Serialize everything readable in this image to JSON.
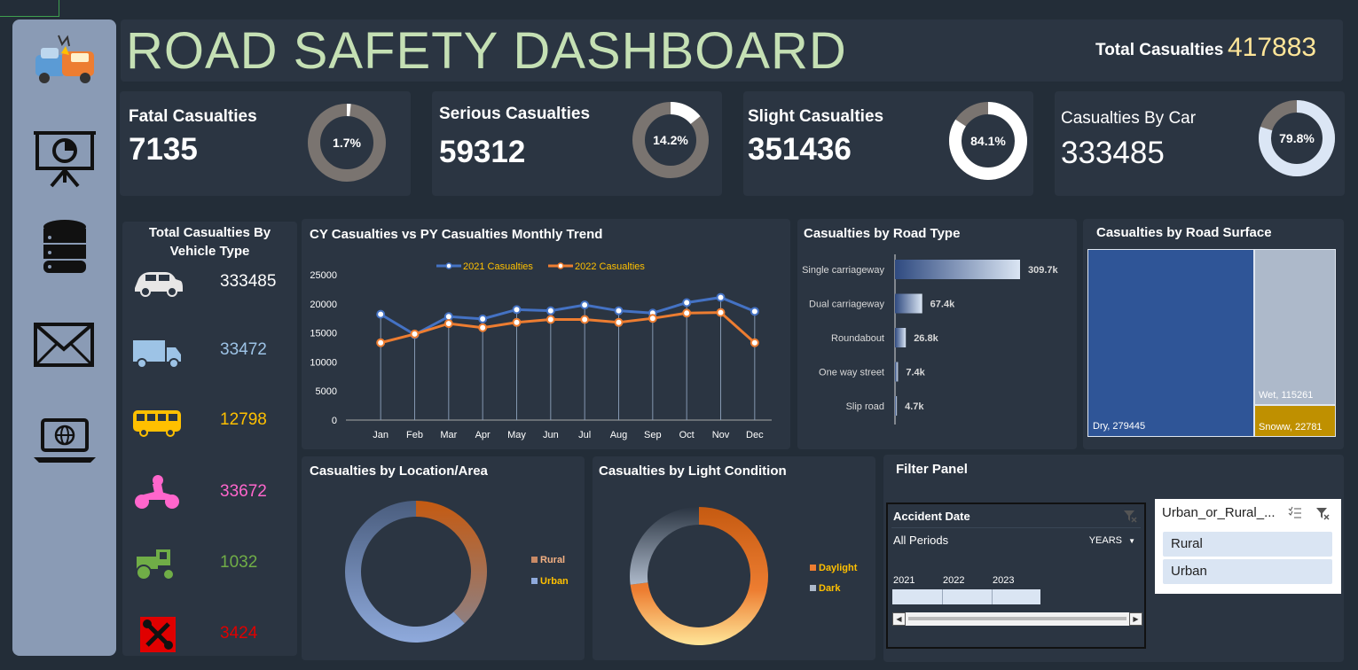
{
  "header": {
    "title": "ROAD SAFETY DASHBOARD",
    "total_label": "Total Casualties",
    "total_value": "417883"
  },
  "sidebar": {
    "icons": [
      "car-crash-icon",
      "presentation-chart-icon",
      "database-icon",
      "mail-icon",
      "laptop-globe-icon"
    ]
  },
  "kpis": [
    {
      "title": "Fatal Casualties",
      "value": "7135",
      "pct_label": "1.7%",
      "pct": 0.017,
      "ring_color": "#ffffff",
      "track_color": "#7a7470"
    },
    {
      "title": "Serious Casualties",
      "value": "59312",
      "pct_label": "14.2%",
      "pct": 0.142,
      "ring_color": "#ffffff",
      "track_color": "#7a7470"
    },
    {
      "title": "Slight Casualties",
      "value": "351436",
      "pct_label": "84.1%",
      "pct": 0.841,
      "ring_color": "#ffffff",
      "track_color": "#7a7470"
    },
    {
      "title": "Casualties By Car",
      "value": "333485",
      "pct_label": "79.8%",
      "pct": 0.798,
      "ring_color": "#dbe6f5",
      "track_color": "#7a7470"
    }
  ],
  "vehicle": {
    "title_line1": "Total Casualties By",
    "title_line2": "Vehicle Type",
    "rows": [
      {
        "icon": "car-icon",
        "value": "333485",
        "color": "#ffffff"
      },
      {
        "icon": "truck-icon",
        "value": "33472",
        "color": "#9dc3e6"
      },
      {
        "icon": "bus-icon",
        "value": "12798",
        "color": "#ffc000"
      },
      {
        "icon": "motorcycle-icon",
        "value": "33672",
        "color": "#ff66cc"
      },
      {
        "icon": "tractor-icon",
        "value": "1032",
        "color": "#70ad47"
      },
      {
        "icon": "tools-icon",
        "value": "3424",
        "color": "#e00000"
      }
    ]
  },
  "trend": {
    "title": "CY Casualties vs PY Casualties Monthly Trend",
    "chart_data": {
      "type": "line",
      "categories": [
        "Jan",
        "Feb",
        "Mar",
        "Apr",
        "May",
        "Jun",
        "Jul",
        "Aug",
        "Sep",
        "Oct",
        "Nov",
        "Dec"
      ],
      "series": [
        {
          "name": "2021 Casualties",
          "color": "#4472c4",
          "values": [
            18200,
            14700,
            17800,
            17400,
            19000,
            18800,
            19800,
            18800,
            18400,
            20200,
            21100,
            18700
          ]
        },
        {
          "name": "2022 Casualties",
          "color": "#ed7d31",
          "values": [
            13300,
            14800,
            16600,
            15900,
            16800,
            17300,
            17300,
            16800,
            17500,
            18400,
            18500,
            13300
          ]
        }
      ],
      "yticks": [
        "0",
        "5000",
        "10000",
        "15000",
        "20000",
        "25000"
      ],
      "ylim": [
        0,
        25000
      ]
    }
  },
  "road_type": {
    "title": "Casualties by Road Type",
    "chart_data": {
      "type": "bar",
      "categories": [
        "Single carriageway",
        "Dual carriageway",
        "Roundabout",
        "One way street",
        "Slip road"
      ],
      "values": [
        309.7,
        67.4,
        26.8,
        7.4,
        4.7
      ],
      "labels": [
        "309.7k",
        "67.4k",
        "26.8k",
        "7.4k",
        "4.7k"
      ]
    }
  },
  "road_surface": {
    "title": "Casualties by Road Surface",
    "chart_data": {
      "type": "heatmap",
      "items": [
        {
          "label": "Dry, 279445",
          "value": 279445,
          "color": "#2f5597"
        },
        {
          "label": "Wet, 115261",
          "value": 115261,
          "color": "#adb9ca"
        },
        {
          "label": "Snoww, 22781",
          "value": 22781,
          "color": "#bf9000"
        }
      ]
    }
  },
  "location": {
    "title": "Casualties by Location/Area",
    "chart_data": {
      "type": "pie",
      "labels": [
        "Rural",
        "Urban"
      ],
      "values": [
        0.38,
        0.62
      ],
      "colors": [
        "#c55a11",
        "#8faadc"
      ]
    },
    "legend": [
      {
        "label": "Rural",
        "color": "#c98a66"
      },
      {
        "label": "Urban",
        "color": "#8faadc"
      }
    ]
  },
  "light": {
    "title": "Casualties by Light Condition",
    "chart_data": {
      "type": "pie",
      "labels": [
        "Daylight",
        "Dark"
      ],
      "values": [
        0.73,
        0.27
      ],
      "colors": [
        "#ed7d31",
        "#adb9ca"
      ]
    },
    "legend": [
      {
        "label": "Daylight",
        "color": "#ed7d31"
      },
      {
        "label": "Dark",
        "color": "#adb9ca"
      }
    ]
  },
  "filter": {
    "title": "Filter Panel",
    "timeline": {
      "title": "Accident Date",
      "period": "All Periods",
      "level": "YEARS",
      "years": [
        "2021",
        "2022",
        "2023"
      ]
    },
    "slicer": {
      "title": "Urban_or_Rural_...",
      "options": [
        "Rural",
        "Urban"
      ]
    }
  }
}
